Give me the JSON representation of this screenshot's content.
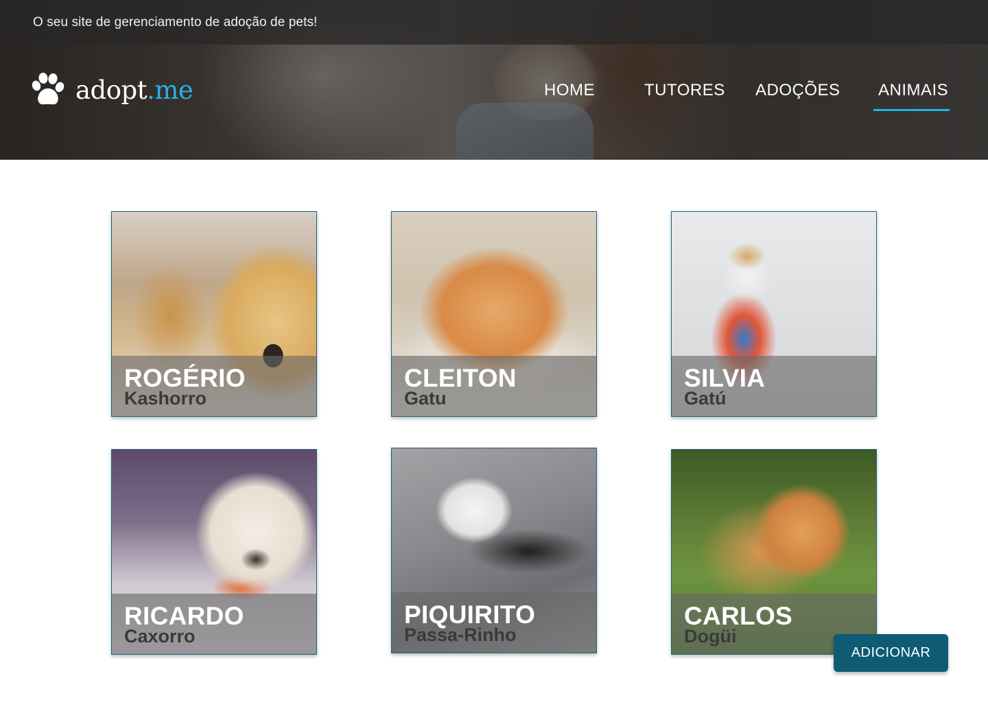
{
  "topbar": {
    "tagline": "O seu site de gerenciamento de adoção de pets!"
  },
  "logo": {
    "name_main": "adopt",
    "name_accent": ".me",
    "icon": "paw-icon"
  },
  "nav": {
    "items": [
      {
        "label": "HOME"
      },
      {
        "label": "TUTORES"
      },
      {
        "label": "ADOÇÕES"
      },
      {
        "label": "ANIMAIS",
        "active": true
      }
    ]
  },
  "animals": [
    {
      "name": "ROGÉRIO",
      "species": "Kashorro"
    },
    {
      "name": "CLEITON",
      "species": "Gatu"
    },
    {
      "name": "SILVIA",
      "species": "Gatú"
    },
    {
      "name": "RICARDO",
      "species": "Caxorro"
    },
    {
      "name": "PIQUIRITO",
      "species": "Passa-Rinho"
    },
    {
      "name": "CARLOS",
      "species": "Dogüi"
    }
  ],
  "actions": {
    "add_label": "ADICIONAR"
  },
  "colors": {
    "accent": "#29b2e6",
    "primary_button": "#0e5b73",
    "card_border": "#1b5f7a"
  }
}
